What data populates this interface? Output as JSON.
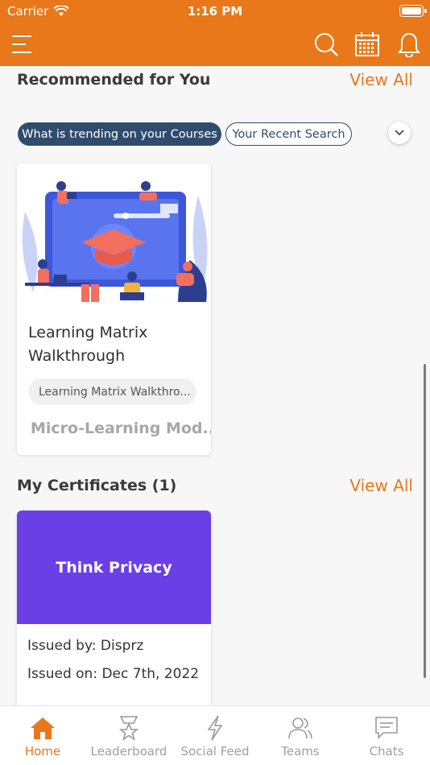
{
  "status_bar": {
    "carrier": "Carrier",
    "time": "1:16 PM"
  },
  "toolbar": {
    "icons": [
      "menu-icon",
      "search-icon",
      "calendar-icon",
      "bell-icon"
    ]
  },
  "recommended": {
    "title": "Recommended for You",
    "view_all": "View All",
    "tabs": [
      {
        "label": "What is trending on your Courses",
        "active": true
      },
      {
        "label": "Your Recent Search",
        "active": false
      }
    ],
    "course": {
      "title": "Learning Matrix Walkthrough",
      "tag": "Learning Matrix Walkthro...",
      "type": "Micro-Learning Mod..."
    }
  },
  "certificates": {
    "title": "My Certificates (1)",
    "view_all": "View All",
    "items": [
      {
        "name": "Think Privacy",
        "issued_by": "Issued by: Disprz",
        "issued_on": "Issued on: Dec 7th, 2022"
      }
    ]
  },
  "bottom_nav": [
    {
      "label": "Home",
      "icon": "home-icon",
      "active": true
    },
    {
      "label": "Leaderboard",
      "icon": "trophy-icon",
      "active": false
    },
    {
      "label": "Social Feed",
      "icon": "lightning-icon",
      "active": false
    },
    {
      "label": "Teams",
      "icon": "people-icon",
      "active": false
    },
    {
      "label": "Chats",
      "icon": "chat-icon",
      "active": false
    }
  ],
  "colors": {
    "brand": "#e8781a",
    "chip_active": "#304b6e",
    "certificate": "#6a3fe6"
  }
}
